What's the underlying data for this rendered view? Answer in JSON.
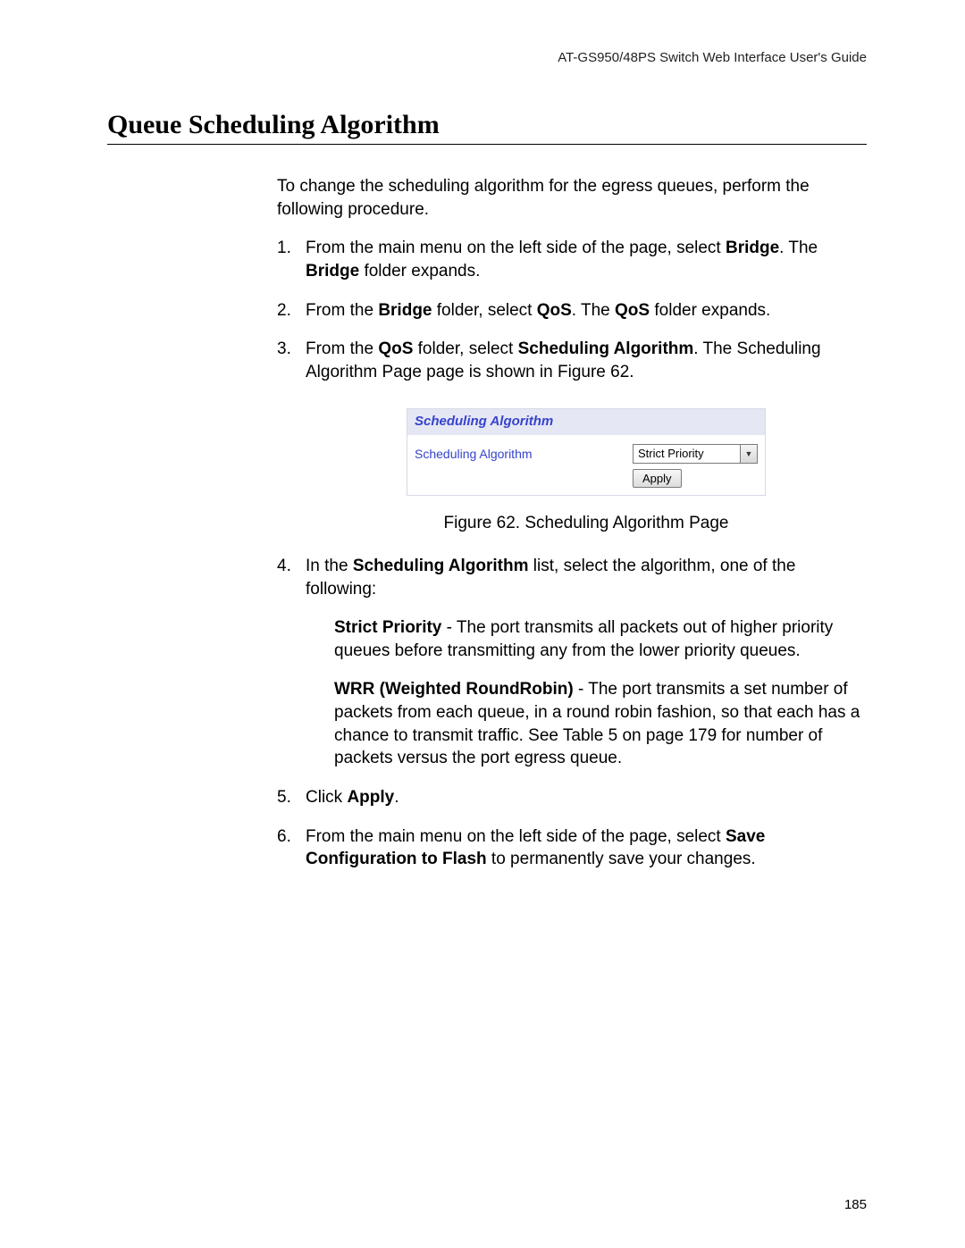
{
  "header": {
    "running_head": "AT-GS950/48PS Switch Web Interface User's Guide"
  },
  "title": "Queue Scheduling Algorithm",
  "intro": "To change the scheduling algorithm for the egress queues, perform the following procedure.",
  "steps": {
    "s1_a": "From the main menu on the left side of the page, select ",
    "s1_bold1": "Bridge",
    "s1_b": ". The ",
    "s1_bold2": "Bridge",
    "s1_c": " folder expands.",
    "s2_a": "From the ",
    "s2_bold1": "Bridge",
    "s2_b": " folder, select ",
    "s2_bold2": "QoS",
    "s2_c": ". The ",
    "s2_bold3": "QoS",
    "s2_d": " folder expands.",
    "s3_a": "From the ",
    "s3_bold1": "QoS",
    "s3_b": " folder, select ",
    "s3_bold2": "Scheduling Algorithm",
    "s3_c": ". The Scheduling Algorithm Page page is shown in Figure 62.",
    "s4_a": "In the ",
    "s4_bold1": "Scheduling Algorithm",
    "s4_b": " list, select the algorithm, one of the following:",
    "s5_a": "Click ",
    "s5_bold1": "Apply",
    "s5_b": ".",
    "s6_a": "From the main menu on the left side of the page, select ",
    "s6_bold1": "Save Configuration to Flash",
    "s6_b": " to permanently save your changes."
  },
  "figure": {
    "panel_title": "Scheduling Algorithm",
    "label": "Scheduling Algorithm",
    "selected": "Strict Priority",
    "apply": "Apply",
    "caption": "Figure 62. Scheduling Algorithm Page"
  },
  "definitions": {
    "d1_bold": "Strict Priority",
    "d1_rest": " - The port transmits all packets out of higher priority queues before transmitting any from the lower priority queues.",
    "d2_bold": "WRR (Weighted RoundRobin)",
    "d2_rest": " - The port transmits a set number of packets from each queue, in a round robin fashion, so that each has a chance to transmit traffic. See Table 5 on page 179 for number of packets versus the port egress queue."
  },
  "page_number": "185"
}
